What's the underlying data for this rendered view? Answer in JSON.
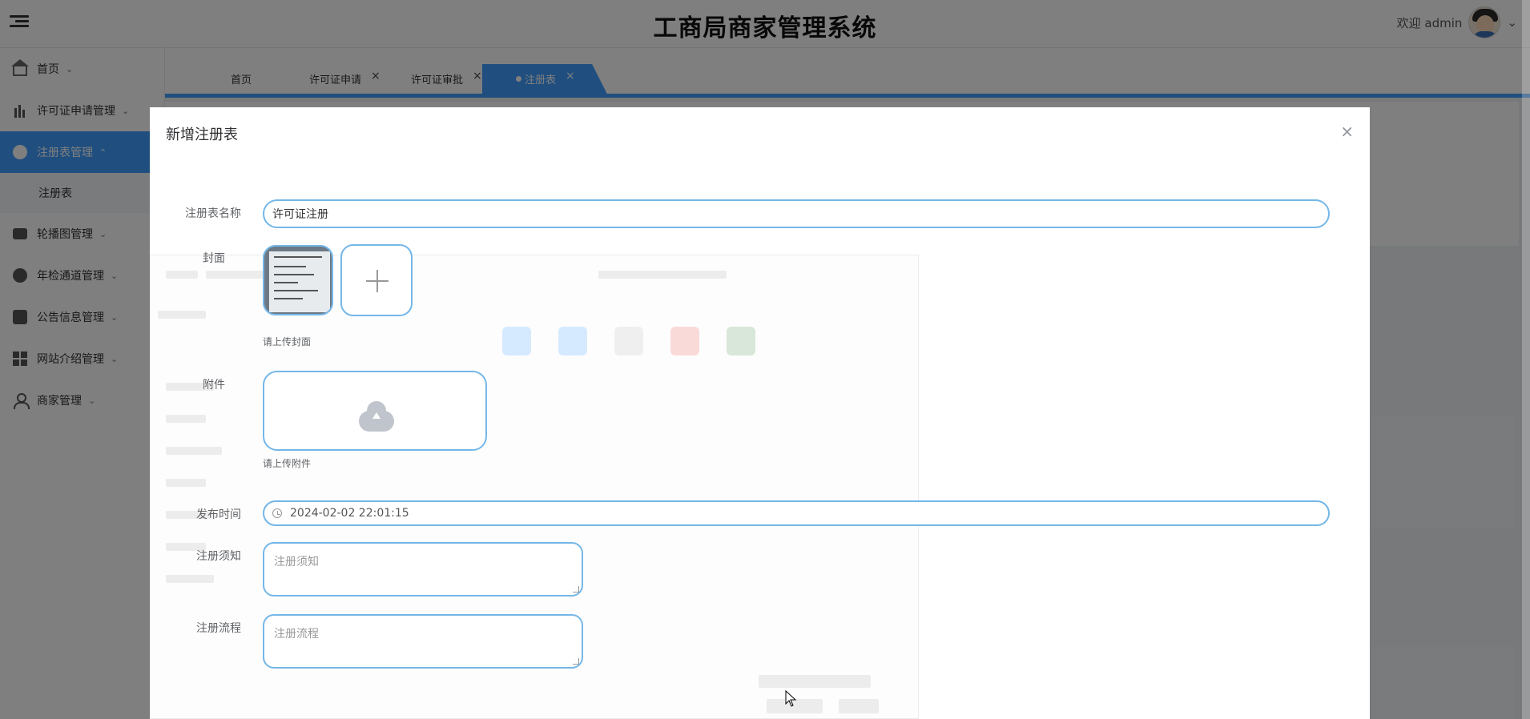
{
  "header": {
    "title": "工商局商家管理系统",
    "welcome": "欢迎 admin",
    "user_menu_arrow": "⌄"
  },
  "sidebar": {
    "items": [
      {
        "label": "首页",
        "icon": "home-icon",
        "chevron": "⌄"
      },
      {
        "label": "许可证申请管理",
        "icon": "chart-icon",
        "chevron": "⌄"
      },
      {
        "label": "注册表管理",
        "icon": "circle-icon",
        "chevron": "⌃"
      },
      {
        "label": "轮播图管理",
        "icon": "briefcase-icon",
        "chevron": "⌄"
      },
      {
        "label": "年检通道管理",
        "icon": "dots-icon",
        "chevron": "⌄"
      },
      {
        "label": "公告信息管理",
        "icon": "copy-icon",
        "chevron": "⌄"
      },
      {
        "label": "网站介绍管理",
        "icon": "grid-icon",
        "chevron": "⌄"
      },
      {
        "label": "商家管理",
        "icon": "user-icon",
        "chevron": "⌄"
      }
    ],
    "subitem": "注册表"
  },
  "tabs": [
    {
      "label": "首页",
      "closable": false
    },
    {
      "label": "许可证申请",
      "closable": true
    },
    {
      "label": "许可证审批",
      "closable": true
    },
    {
      "label": "注册表",
      "closable": true,
      "active": true
    }
  ],
  "tab_close_glyph": "×",
  "dialog": {
    "title": "新增注册表",
    "close_glyph": "×",
    "fields": {
      "name_label": "注册表名称",
      "name_value": "许可证注册",
      "cover_label": "封面",
      "cover_hint": "请上传封面",
      "attachment_label": "附件",
      "attachment_hint": "请上传附件",
      "publish_label": "发布时间",
      "publish_value": "2024-02-02 22:01:15",
      "notice_label": "注册须知",
      "notice_placeholder": "注册须知",
      "process_label": "注册流程",
      "process_placeholder": "注册流程"
    }
  }
}
